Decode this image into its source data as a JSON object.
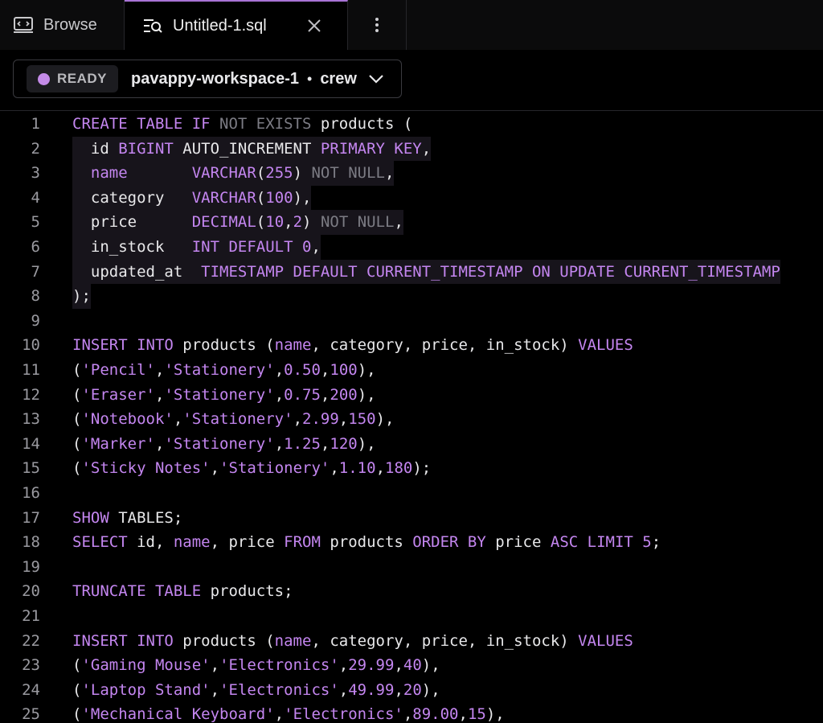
{
  "tabs": {
    "browse_label": "Browse",
    "file_label": "Untitled-1.sql"
  },
  "workspace": {
    "status": "READY",
    "name": "pavappy-workspace-1",
    "separator": "•",
    "role": "crew"
  },
  "colors": {
    "accent": "#c486f0",
    "status_dot": "#c48be8",
    "background": "#000000"
  },
  "icons": {
    "browse": "browse-icon",
    "query": "query-icon",
    "close": "close-icon",
    "more": "more-vertical-icon",
    "chevron": "chevron-down-icon"
  },
  "editor": {
    "lines": [
      {
        "n": "1",
        "tokens": [
          [
            "kw",
            "CREATE TABLE IF "
          ],
          [
            "mut",
            "NOT EXISTS "
          ],
          [
            "pl",
            "products ("
          ]
        ]
      },
      {
        "n": "2",
        "tokens": [
          [
            "pl",
            "  id "
          ],
          [
            "kw",
            "BIGINT "
          ],
          [
            "pl",
            "AUTO_INCREMENT "
          ],
          [
            "kw",
            "PRIMARY KEY"
          ],
          [
            "pl",
            ","
          ]
        ]
      },
      {
        "n": "3",
        "tokens": [
          [
            "pl",
            "  "
          ],
          [
            "kw",
            "name"
          ],
          [
            "pl",
            "       "
          ],
          [
            "kw",
            "VARCHAR"
          ],
          [
            "pl",
            "("
          ],
          [
            "num",
            "255"
          ],
          [
            "pl",
            ") "
          ],
          [
            "mut",
            "NOT NULL"
          ],
          [
            "pl",
            ","
          ]
        ]
      },
      {
        "n": "4",
        "tokens": [
          [
            "pl",
            "  category   "
          ],
          [
            "kw",
            "VARCHAR"
          ],
          [
            "pl",
            "("
          ],
          [
            "num",
            "100"
          ],
          [
            "pl",
            "),"
          ]
        ]
      },
      {
        "n": "5",
        "tokens": [
          [
            "pl",
            "  price      "
          ],
          [
            "kw",
            "DECIMAL"
          ],
          [
            "pl",
            "("
          ],
          [
            "num",
            "10"
          ],
          [
            "pl",
            ","
          ],
          [
            "num",
            "2"
          ],
          [
            "pl",
            ") "
          ],
          [
            "mut",
            "NOT NULL"
          ],
          [
            "pl",
            ","
          ]
        ]
      },
      {
        "n": "6",
        "tokens": [
          [
            "pl",
            "  in_stock   "
          ],
          [
            "kw",
            "INT DEFAULT "
          ],
          [
            "num",
            "0"
          ],
          [
            "pl",
            ","
          ]
        ]
      },
      {
        "n": "7",
        "tokens": [
          [
            "pl",
            "  updated_at  "
          ],
          [
            "kw",
            "TIMESTAMP DEFAULT CURRENT_TIMESTAMP ON UPDATE CURRENT_TIMESTAMP"
          ]
        ]
      },
      {
        "n": "8",
        "tokens": [
          [
            "pl",
            ");"
          ]
        ]
      },
      {
        "n": "9",
        "tokens": []
      },
      {
        "n": "10",
        "tokens": [
          [
            "kw",
            "INSERT INTO "
          ],
          [
            "pl",
            "products ("
          ],
          [
            "kw",
            "name"
          ],
          [
            "pl",
            ", category, price, in_stock) "
          ],
          [
            "kw",
            "VALUES"
          ]
        ]
      },
      {
        "n": "11",
        "tokens": [
          [
            "pl",
            "("
          ],
          [
            "str",
            "'Pencil'"
          ],
          [
            "pl",
            ","
          ],
          [
            "str",
            "'Stationery'"
          ],
          [
            "pl",
            ","
          ],
          [
            "num",
            "0.50"
          ],
          [
            "pl",
            ","
          ],
          [
            "num",
            "100"
          ],
          [
            "pl",
            "),"
          ]
        ]
      },
      {
        "n": "12",
        "tokens": [
          [
            "pl",
            "("
          ],
          [
            "str",
            "'Eraser'"
          ],
          [
            "pl",
            ","
          ],
          [
            "str",
            "'Stationery'"
          ],
          [
            "pl",
            ","
          ],
          [
            "num",
            "0.75"
          ],
          [
            "pl",
            ","
          ],
          [
            "num",
            "200"
          ],
          [
            "pl",
            "),"
          ]
        ]
      },
      {
        "n": "13",
        "tokens": [
          [
            "pl",
            "("
          ],
          [
            "str",
            "'Notebook'"
          ],
          [
            "pl",
            ","
          ],
          [
            "str",
            "'Stationery'"
          ],
          [
            "pl",
            ","
          ],
          [
            "num",
            "2.99"
          ],
          [
            "pl",
            ","
          ],
          [
            "num",
            "150"
          ],
          [
            "pl",
            "),"
          ]
        ]
      },
      {
        "n": "14",
        "tokens": [
          [
            "pl",
            "("
          ],
          [
            "str",
            "'Marker'"
          ],
          [
            "pl",
            ","
          ],
          [
            "str",
            "'Stationery'"
          ],
          [
            "pl",
            ","
          ],
          [
            "num",
            "1.25"
          ],
          [
            "pl",
            ","
          ],
          [
            "num",
            "120"
          ],
          [
            "pl",
            "),"
          ]
        ]
      },
      {
        "n": "15",
        "tokens": [
          [
            "pl",
            "("
          ],
          [
            "str",
            "'Sticky Notes'"
          ],
          [
            "pl",
            ","
          ],
          [
            "str",
            "'Stationery'"
          ],
          [
            "pl",
            ","
          ],
          [
            "num",
            "1.10"
          ],
          [
            "pl",
            ","
          ],
          [
            "num",
            "180"
          ],
          [
            "pl",
            ");"
          ]
        ]
      },
      {
        "n": "16",
        "tokens": []
      },
      {
        "n": "17",
        "tokens": [
          [
            "kw",
            "SHOW "
          ],
          [
            "pl",
            "TABLES;"
          ]
        ]
      },
      {
        "n": "18",
        "tokens": [
          [
            "kw",
            "SELECT "
          ],
          [
            "pl",
            "id, "
          ],
          [
            "kw",
            "name"
          ],
          [
            "pl",
            ", price "
          ],
          [
            "kw",
            "FROM "
          ],
          [
            "pl",
            "products "
          ],
          [
            "kw",
            "ORDER BY "
          ],
          [
            "pl",
            "price "
          ],
          [
            "kw",
            "ASC LIMIT "
          ],
          [
            "num",
            "5"
          ],
          [
            "pl",
            ";"
          ]
        ]
      },
      {
        "n": "19",
        "tokens": []
      },
      {
        "n": "20",
        "tokens": [
          [
            "kw",
            "TRUNCATE TABLE "
          ],
          [
            "pl",
            "products;"
          ]
        ]
      },
      {
        "n": "21",
        "tokens": []
      },
      {
        "n": "22",
        "tokens": [
          [
            "kw",
            "INSERT INTO "
          ],
          [
            "pl",
            "products ("
          ],
          [
            "kw",
            "name"
          ],
          [
            "pl",
            ", category, price, in_stock) "
          ],
          [
            "kw",
            "VALUES"
          ]
        ]
      },
      {
        "n": "23",
        "tokens": [
          [
            "pl",
            "("
          ],
          [
            "str",
            "'Gaming Mouse'"
          ],
          [
            "pl",
            ","
          ],
          [
            "str",
            "'Electronics'"
          ],
          [
            "pl",
            ","
          ],
          [
            "num",
            "29.99"
          ],
          [
            "pl",
            ","
          ],
          [
            "num",
            "40"
          ],
          [
            "pl",
            "),"
          ]
        ]
      },
      {
        "n": "24",
        "tokens": [
          [
            "pl",
            "("
          ],
          [
            "str",
            "'Laptop Stand'"
          ],
          [
            "pl",
            ","
          ],
          [
            "str",
            "'Electronics'"
          ],
          [
            "pl",
            ","
          ],
          [
            "num",
            "49.99"
          ],
          [
            "pl",
            ","
          ],
          [
            "num",
            "20"
          ],
          [
            "pl",
            "),"
          ]
        ]
      },
      {
        "n": "25",
        "tokens": [
          [
            "pl",
            "("
          ],
          [
            "str",
            "'Mechanical Keyboard'"
          ],
          [
            "pl",
            ","
          ],
          [
            "str",
            "'Electronics'"
          ],
          [
            "pl",
            ","
          ],
          [
            "num",
            "89.00"
          ],
          [
            "pl",
            ","
          ],
          [
            "num",
            "15"
          ],
          [
            "pl",
            "),"
          ]
        ]
      }
    ]
  }
}
